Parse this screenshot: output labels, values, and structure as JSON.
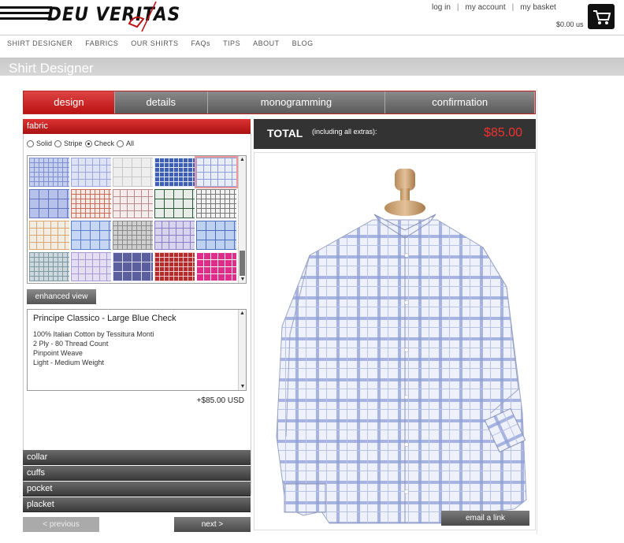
{
  "header": {
    "logo_text": "DEU VERITAS",
    "links": [
      "log in",
      "my account",
      "my basket"
    ],
    "separator": "|",
    "basket_total": "$0.00 us"
  },
  "nav": {
    "items": [
      "SHIRT DESIGNER",
      "FABRICS",
      "OUR SHIRTS",
      "FAQs",
      "TIPS",
      "ABOUT",
      "BLOG"
    ]
  },
  "page": {
    "title": "Shirt Designer"
  },
  "tabs": [
    {
      "label": "design",
      "active": true
    },
    {
      "label": "details",
      "active": false
    },
    {
      "label": "monogramming",
      "active": false
    },
    {
      "label": "confirmation",
      "active": false
    }
  ],
  "fabric": {
    "heading": "fabric",
    "filters": [
      {
        "label": "Solid",
        "selected": false
      },
      {
        "label": "Stripe",
        "selected": false
      },
      {
        "label": "Check",
        "selected": true
      },
      {
        "label": "All",
        "selected": false
      }
    ],
    "enhanced_view_label": "enhanced view",
    "selected_name": "Principe Classico - Large Blue Check",
    "details": [
      "100% Italian Cotton by Tessitura Monti",
      "2 Ply - 80 Thread Count",
      "Pinpoint Weave",
      "Light - Medium Weight"
    ],
    "price": "+$85.00 USD"
  },
  "sections": [
    "collar",
    "cuffs",
    "pocket",
    "placket"
  ],
  "buttons": {
    "previous": "< previous",
    "next": "next >",
    "email": "email a link"
  },
  "total": {
    "label": "TOTAL",
    "note": "(including all extras):",
    "price": "$85.00"
  },
  "colors": {
    "accent_red": "#c12222",
    "tab_gray": "#5a5a5a",
    "total_bar": "#333333",
    "price_red": "#e33333"
  }
}
